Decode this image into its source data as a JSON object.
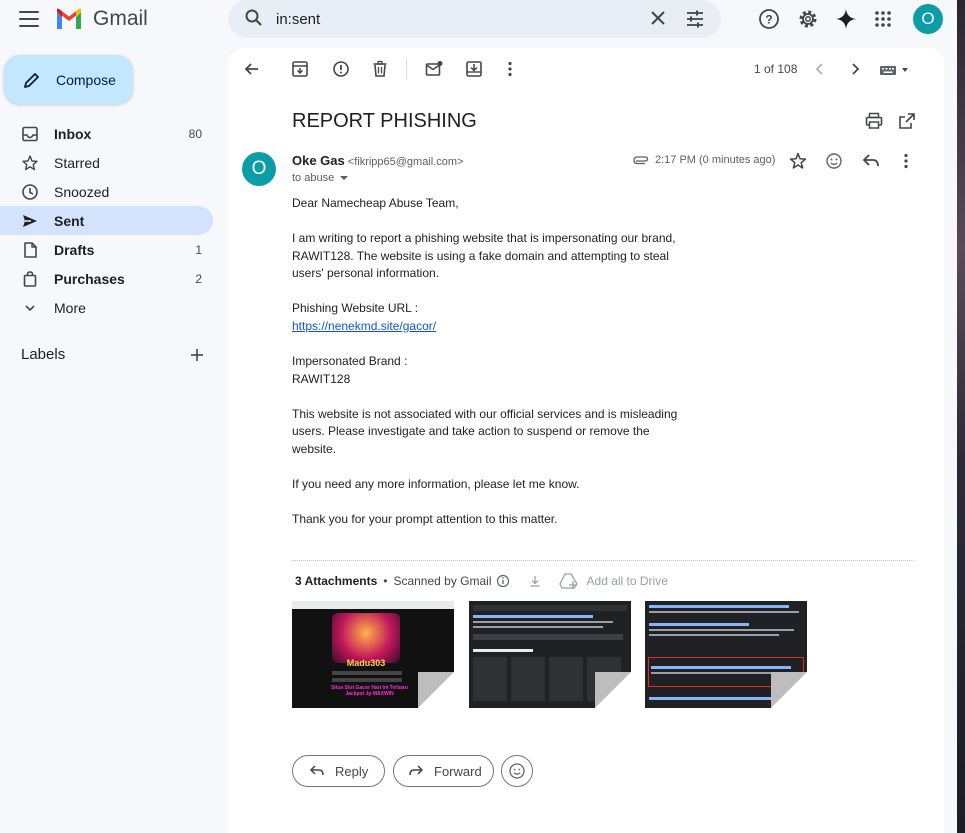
{
  "app": {
    "name": "Gmail"
  },
  "search": {
    "value": "in:sent"
  },
  "sidebar": {
    "compose_label": "Compose",
    "items": [
      {
        "label": "Inbox",
        "count": "80"
      },
      {
        "label": "Starred",
        "count": ""
      },
      {
        "label": "Snoozed",
        "count": ""
      },
      {
        "label": "Sent",
        "count": ""
      },
      {
        "label": "Drafts",
        "count": "1"
      },
      {
        "label": "Purchases",
        "count": "2"
      },
      {
        "label": "More",
        "count": ""
      }
    ],
    "labels_title": "Labels"
  },
  "toolbar": {
    "pager": "1 of 108"
  },
  "email": {
    "subject": "REPORT PHISHING",
    "sender_name": "Oke Gas",
    "sender_email": "<fikripp65@gmail.com>",
    "avatar_letter": "O",
    "to": "to abuse",
    "time": "2:17 PM (0 minutes ago)",
    "body": {
      "greeting": "Dear Namecheap Abuse Team,",
      "p1": "I am writing to report a phishing website that is impersonating our brand, RAWIT128. The website is using a fake domain and attempting to steal users' personal information.",
      "url_label": "Phishing Website URL :",
      "url": "https://nenekmd.site/gacor/",
      "brand_label": "Impersonated Brand :",
      "brand": "RAWIT128",
      "p2": "This website is not associated with our official services and is misleading users. Please investigate and take action to suspend or remove the website.",
      "p3": "If you need any more information, please let me know.",
      "p4": "Thank you for your prompt attention to this matter."
    },
    "attachments": {
      "title": "3 Attachments",
      "scanned": "Scanned by Gmail",
      "add_to_drive": "Add all to Drive",
      "thumb1_brand": "Madu303",
      "thumb1_tagline": "Situs Slot Gacor Hari Ini Terbaru Jackpot Jp MAXWIN"
    }
  },
  "actions": {
    "reply": "Reply",
    "forward": "Forward"
  },
  "colors": {
    "accent": "#0b9ea6",
    "compose_bg": "#c2e7ff",
    "active_nav": "#d3e3fd",
    "link": "#1155cc"
  }
}
